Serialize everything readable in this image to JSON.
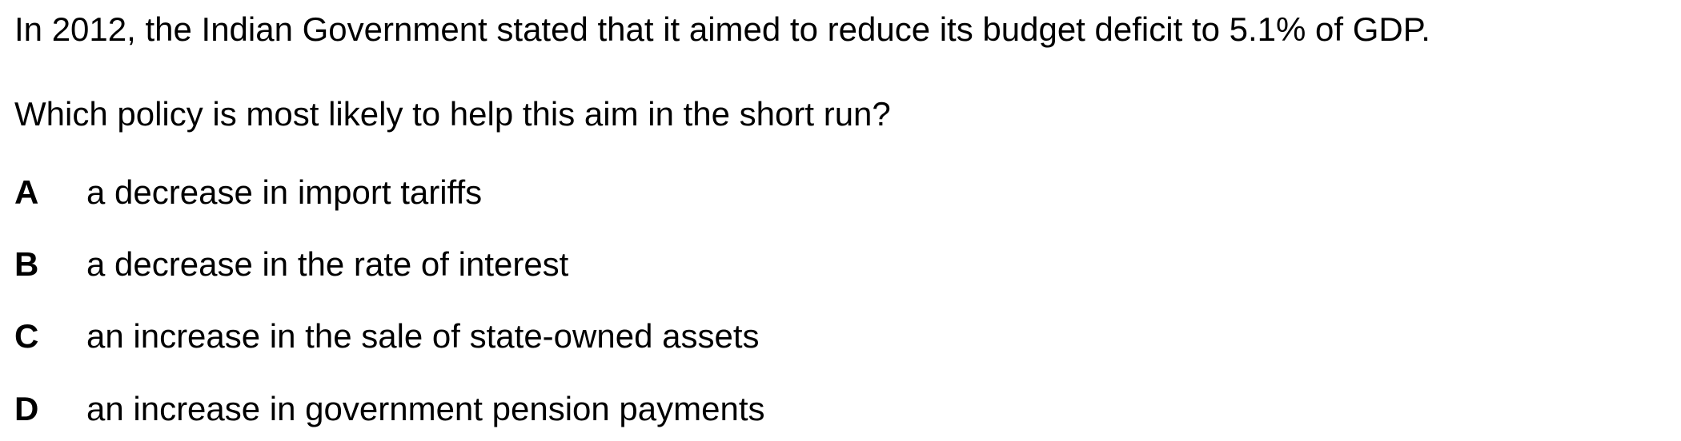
{
  "question": {
    "stem": "In 2012, the Indian Government stated that it aimed to reduce its budget deficit to 5.1% of GDP.",
    "prompt": "Which policy is most likely to help this aim in the short run?",
    "options": [
      {
        "letter": "A",
        "text": "a decrease in import tariffs"
      },
      {
        "letter": "B",
        "text": "a decrease in the rate of interest"
      },
      {
        "letter": "C",
        "text": "an increase in the sale of state-owned assets"
      },
      {
        "letter": "D",
        "text": "an increase in government pension payments"
      }
    ]
  }
}
